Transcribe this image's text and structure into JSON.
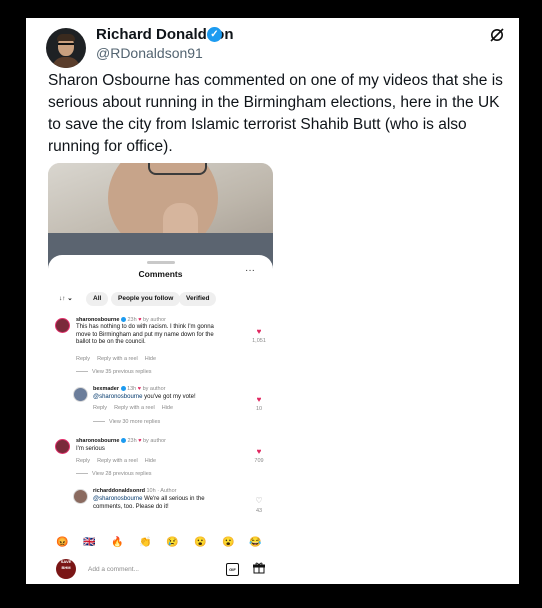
{
  "tweet": {
    "author_name": "Richard Donaldson",
    "author_handle": "@RDonaldson91",
    "verified_icon": "blue-check-icon",
    "text": "Sharon Osbourne has commented on one of my videos that she is serious about running in the Birmingham elections, here in the UK to save the city from Islamic terrorist Shahib Butt (who is also running for office)."
  },
  "comments_panel": {
    "title": "Comments",
    "more": "···",
    "sort_icon": "↓↑ ⌄",
    "filters": [
      "All",
      "People you follow",
      "Verified"
    ],
    "comments": [
      {
        "user": "sharonosbourne",
        "time": "23h",
        "by_author": "by author",
        "text": "This has nothing to do with racism. I think I'm gonna move to Birmingham and put my name down for the ballot to be on the council.",
        "reply": "Reply",
        "reply_reel": "Reply with a reel",
        "hide": "Hide",
        "likes": "1,051",
        "view_replies": "View 35 previous replies"
      },
      {
        "user": "bexmader",
        "time": "13h",
        "by_author": "by author",
        "mention": "@sharonosbourne",
        "text": " you've got my vote!",
        "reply": "Reply",
        "reply_reel": "Reply with a reel",
        "hide": "Hide",
        "likes": "10",
        "view_replies": "View 30 more replies"
      },
      {
        "user": "sharonosbourne",
        "time": "23h",
        "by_author": "by author",
        "text": "I'm serious",
        "reply": "Reply",
        "reply_reel": "Reply with a reel",
        "hide": "Hide",
        "likes": "709",
        "view_replies": "View 28 previous replies"
      },
      {
        "user": "richarddonaldsonrd",
        "time": "10h",
        "by_author": "Author",
        "mention": "@sharonosbourne",
        "text": " We're all serious in the comments, too. Please do it!",
        "likes": "43"
      }
    ],
    "emoji_row": [
      "😡",
      "🇬🇧",
      "🔥",
      "👏",
      "😢",
      "😮",
      "😮",
      "😂"
    ],
    "add_comment_placeholder": "Add a comment...",
    "gif_label": "GIF",
    "avatar_text": "SAVE BHM"
  }
}
